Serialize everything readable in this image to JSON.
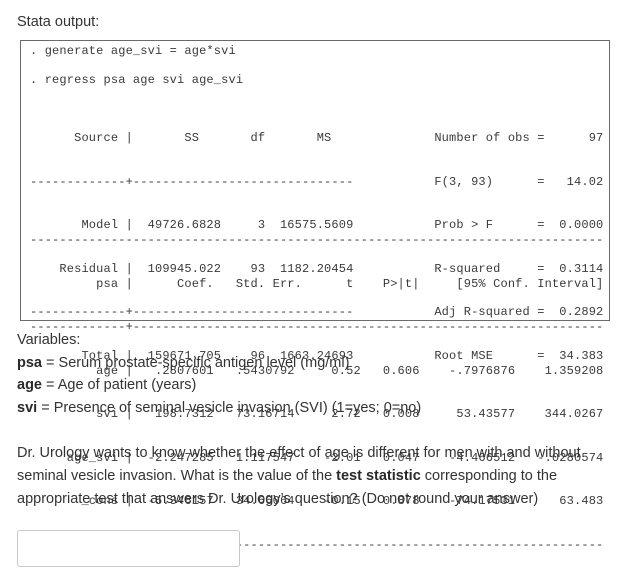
{
  "heading": "Stata output:",
  "stata": {
    "commands": [
      ". generate age_svi = age*svi",
      ". regress psa age svi age_svi"
    ],
    "anova_lines": [
      "      Source |       SS       df       MS              Number of obs =      97",
      "-------------+------------------------------           F(3, 93)      =   14.02",
      "       Model |  49726.6828     3  16575.5609           Prob > F      =  0.0000",
      "    Residual |  109945.022    93  1182.20454           R-squared     =  0.3114",
      "-------------+------------------------------           Adj R-squared =  0.2892",
      "       Total |  159671.705    96  1663.24693           Root MSE      =  34.383"
    ],
    "anova": {
      "columns": [
        "Source",
        "SS",
        "df",
        "MS"
      ],
      "rows": [
        {
          "source": "Model",
          "ss": "49726.6828",
          "df": "3",
          "ms": "16575.5609"
        },
        {
          "source": "Residual",
          "ss": "109945.022",
          "df": "93",
          "ms": "1182.20454"
        },
        {
          "source": "Total",
          "ss": "159671.705",
          "df": "96",
          "ms": "1663.24693"
        }
      ],
      "stats": [
        {
          "label": "Number of obs",
          "value": "97"
        },
        {
          "label": "F(3, 93)",
          "value": "14.02"
        },
        {
          "label": "Prob > F",
          "value": "0.0000"
        },
        {
          "label": "R-squared",
          "value": "0.3114"
        },
        {
          "label": "Adj R-squared",
          "value": "0.2892"
        },
        {
          "label": "Root MSE",
          "value": "34.383"
        }
      ]
    },
    "coef_lines": [
      "------------------------------------------------------------------------------",
      "         psa |      Coef.   Std. Err.      t    P>|t|     [95% Conf. Interval]",
      "-------------+----------------------------------------------------------------",
      "         age |   .2807601   .5430792     0.52   0.606    -.7976876    1.359208",
      "         svi |   198.7312   73.16714     2.72   0.008     53.43577    344.0267",
      "     age_svi |  -2.247285   1.117547    -2.01   0.047    -4.466512   -.0280574",
      "       _cons |  -5.346157   34.66064    -0.15   0.878    -74.17531      63.483",
      "------------------------------------------------------------------------------"
    ],
    "coefficients": {
      "columns": [
        "psa",
        "Coef.",
        "Std. Err.",
        "t",
        "P>|t|",
        "[95% Conf.",
        "Interval]"
      ],
      "rows": [
        {
          "var": "age",
          "coef": ".2807601",
          "se": ".5430792",
          "t": "0.52",
          "p": "0.606",
          "ci_low": "-.7976876",
          "ci_high": "1.359208"
        },
        {
          "var": "svi",
          "coef": "198.7312",
          "se": "73.16714",
          "t": "2.72",
          "p": "0.008",
          "ci_low": "53.43577",
          "ci_high": "344.0267"
        },
        {
          "var": "age_svi",
          "coef": "-2.247285",
          "se": "1.117547",
          "t": "-2.01",
          "p": "0.047",
          "ci_low": "-4.466512",
          "ci_high": "-.0280574"
        },
        {
          "var": "_cons",
          "coef": "-5.346157",
          "se": "34.66064",
          "t": "-0.15",
          "p": "0.878",
          "ci_low": "-74.17531",
          "ci_high": "63.483"
        }
      ]
    }
  },
  "variables": {
    "title": "Variables:",
    "items": [
      {
        "name": "psa",
        "desc": " = Serum prostate-specific antigen level (mg/ml)"
      },
      {
        "name": "age",
        "desc": " = Age of patient (years)"
      },
      {
        "name": "svi",
        "desc": " = Presence of seminal vesicle invasion (SVI) (1=yes; 0=no)"
      }
    ]
  },
  "question": {
    "part1": "Dr. Urology wants to know whether the effect of age is different for men with and without seminal vesicle invasion. What is the value of the ",
    "bold": "test statistic",
    "part2": " corresponding to the appropriate test that answers Dr. Urology’s question? (Do not round your answer)"
  },
  "answer": {
    "value": "",
    "placeholder": ""
  }
}
